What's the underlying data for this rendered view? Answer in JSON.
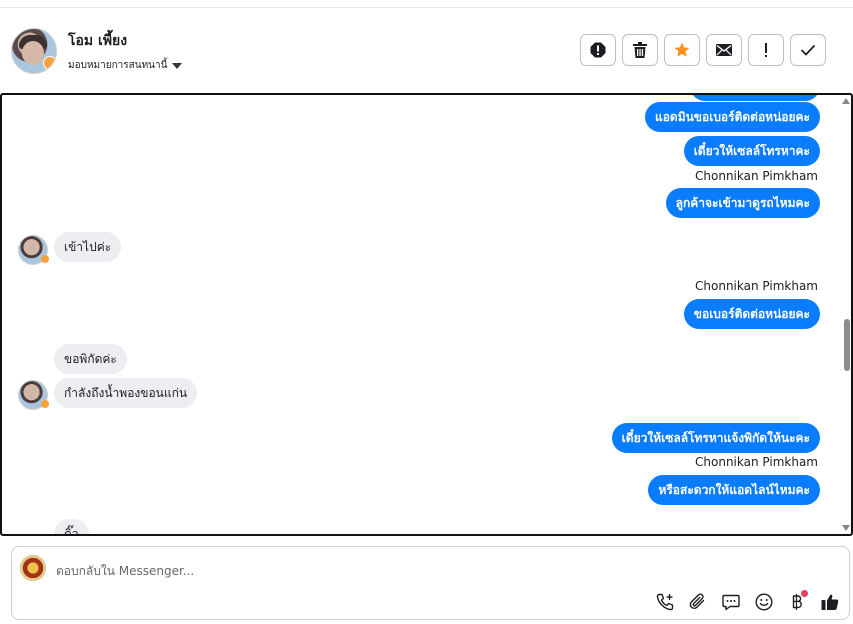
{
  "header": {
    "user_name": "โอม เพี้ยง",
    "assign_label": "มอบหมายการสนทนานี้",
    "actions": [
      "spam-icon",
      "trash-icon",
      "star-icon",
      "mail-icon",
      "important-icon",
      "check-icon"
    ]
  },
  "messages": {
    "m1": "แอดมินขอเบอร์ติดต่อหน่อยคะ",
    "m2": "เดี๋ยวให้เซลล์โทรหาคะ",
    "sender1": "Chonnikan Pimkham",
    "m3": "ลูกค้าจะเข้ามาดูรถไหมคะ",
    "m4": "เข้าไปค่ะ",
    "sender2": "Chonnikan Pimkham",
    "m5": "ขอเบอร์ติดต่อหน่อยคะ",
    "m6": "ขอพิกัดค่ะ",
    "m7": "กำลังถึงน้ำพองขอนแก่น",
    "m8": "เดี๋ยวให้เซลล์โทรหาแจ้งพิกัดให้นะคะ",
    "sender3": "Chonnikan Pimkham",
    "m9": "หรือสะดวกให้แอดไลน์ไหมคะ",
    "m10": "ดิ๊ว"
  },
  "reply": {
    "placeholder": "ตอบกลับใน Messenger..."
  },
  "toolbar_icons": [
    "call-add-icon",
    "paperclip-icon",
    "saved-reply-icon",
    "emoji-icon",
    "baht-icon",
    "thumbs-up-icon"
  ],
  "colors": {
    "outgoing_bubble": "#0a7cff",
    "incoming_bubble": "#eceef1",
    "star": "#f7931e"
  }
}
